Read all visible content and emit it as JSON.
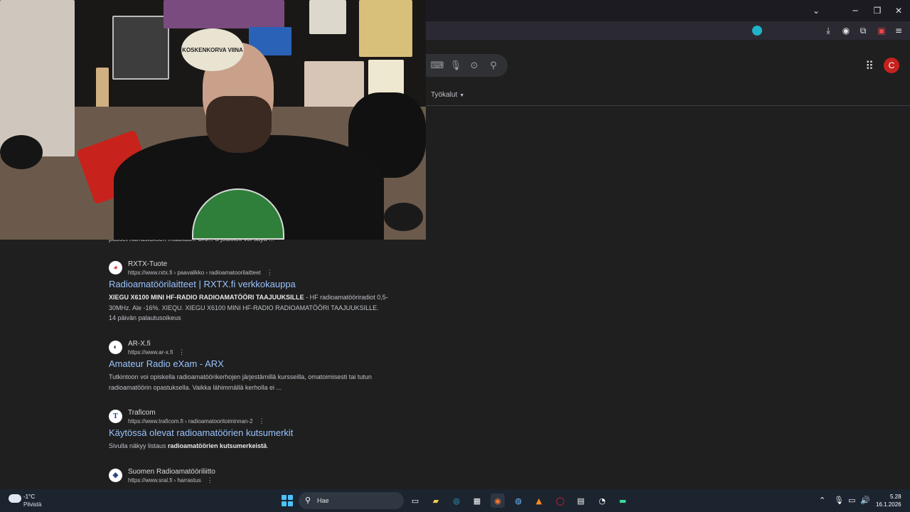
{
  "window": {
    "minimize_icon": "minimize-icon",
    "maximize_icon": "restore-icon",
    "close_icon": "close-icon",
    "dropdown_icon": "chevron-down-icon"
  },
  "toolbar": {
    "icons": [
      "download-icon",
      "account-icon",
      "extensions-icon",
      "addon-icon",
      "menu-icon"
    ]
  },
  "google": {
    "search_icons": [
      "keyboard-icon",
      "mic-icon",
      "lens-icon",
      "search-icon"
    ],
    "tools_label": "Työkalut",
    "avatar_letter": "C",
    "avatar_color": "#c5221f"
  },
  "webcam": {
    "poster_text": "KOSKENKORVA VIINA"
  },
  "results": {
    "cut_snippet": "passet harrastuksen maailaan. Uro... a joukkeli voi saya ...",
    "items": [
      {
        "site_name": "RXTX-Tuote",
        "url": "https://www.rxtx.fi › paavalikko › radioamatoorilaitteet",
        "title": "Radioamatöörilaitteet | RXTX.fi verkkokauppa",
        "snippet_bold": "XIEGU X6100 MINI HF-RADIO RADIOAMATÖÖRI TAAJUUKSILLE",
        "snippet_rest": " - HF radioamatööriradiot 0,5-30MHz. Ale -16%. XIEQU. XIEGU X6100 MINI HF-RADIO RADIOAMATÖÖRI TAAJUUKSILLE.",
        "extra": "14 päivän palautusoikeus",
        "favicon_color": "#ffffff"
      },
      {
        "site_name": "AR-X.fi",
        "url": "https://www.ar-x.fi",
        "title": "Amateur Radio eXam - ARX",
        "snippet": "Tutkintoon voi opiskella radioamatöörikerhojen järjestämillä kursseilla, omatoimisesti tai tutun radioamatöörin opastuksella. Vaikka lähimmällä kerholla ei ...",
        "favicon_color": "#ffffff"
      },
      {
        "site_name": "Traficom",
        "url": "https://www.traficom.fi › radioamatooritoiminnan-2",
        "title": "Käytössä olevat radioamatöörien kutsumerkit",
        "snippet_pre": "Sivulla näkyy listaus ",
        "snippet_bold": "radioamatöörien kutsumerkeistä",
        "snippet_post": ".",
        "favicon_letter": "T",
        "favicon_color": "#ffffff"
      },
      {
        "site_name": "Suomen Radioamatööriliitto",
        "url": "https://www.sral.fi › harrastus",
        "favicon_color": "#ffffff"
      }
    ]
  },
  "taskbar": {
    "weather_temp": "-1°C",
    "weather_desc": "Pilvistä",
    "search_label": "Hae",
    "apps": [
      "task-view-icon",
      "file-explorer-icon",
      "edge-icon",
      "store-icon",
      "firefox-icon",
      "steam-icon",
      "vlc-icon",
      "opera-icon",
      "terminal-icon",
      "obs-icon",
      "app-icon"
    ],
    "time": "5.28",
    "date": "16.1.2026"
  }
}
